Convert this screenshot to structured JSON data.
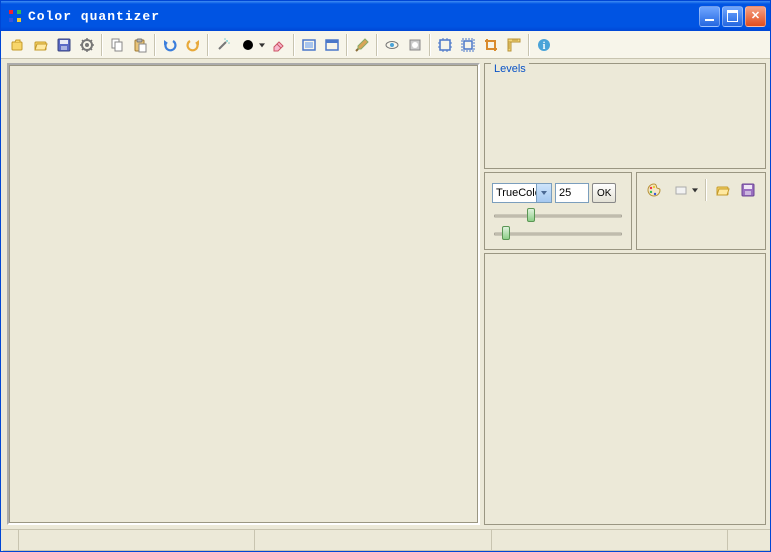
{
  "window": {
    "title": "Color quantizer"
  },
  "toolbar": {
    "open": "open-file",
    "folder": "browse-folder",
    "save": "save",
    "settings": "settings-gear",
    "copy": "copy",
    "paste": "paste",
    "undo": "undo",
    "redo": "redo",
    "color_picker": "color-picker",
    "current_color": "#000000",
    "eraser": "eraser",
    "fit": "fit-window",
    "zoom": "zoom-actual",
    "brush": "brush",
    "eye": "preview",
    "mask": "mask",
    "crop1": "crop-inside",
    "crop2": "crop-outside",
    "crop3": "crop-manual",
    "ruler": "ruler",
    "info": "info"
  },
  "right": {
    "levels_title": "Levels",
    "mode_selected": "TrueColor",
    "count_value": "25",
    "ok_label": "OK",
    "slider1": 35,
    "slider2": 10
  }
}
